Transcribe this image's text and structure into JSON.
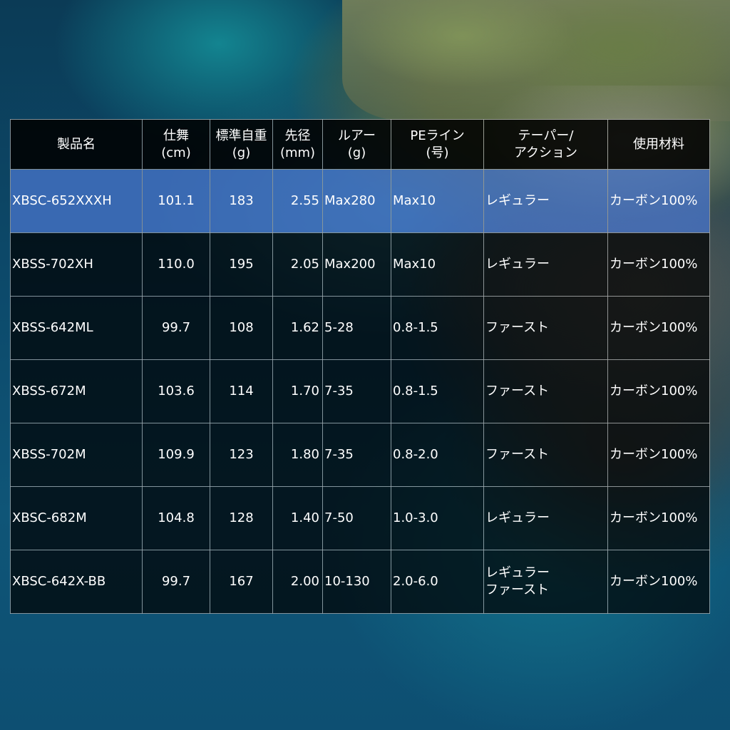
{
  "table": {
    "headers": [
      [
        "製品名"
      ],
      [
        "仕舞",
        "(cm)"
      ],
      [
        "標準自重",
        "(g)"
      ],
      [
        "先径",
        "(mm)"
      ],
      [
        "ルアー",
        "(g)"
      ],
      [
        "PEライン",
        "(号)"
      ],
      [
        "テーパー/",
        "アクション"
      ],
      [
        "使用材料"
      ]
    ],
    "rows": [
      {
        "name": "XBSC-652XXXH",
        "length": "101.1",
        "weight": "183",
        "tip": "2.55",
        "lure": "Max280",
        "line": "Max10",
        "action": [
          "レギュラー"
        ],
        "material": "カーボン100%",
        "highlighted": true
      },
      {
        "name": "XBSS-702XH",
        "length": "110.0",
        "weight": "195",
        "tip": "2.05",
        "lure": "Max200",
        "line": "Max10",
        "action": [
          "レギュラー"
        ],
        "material": "カーボン100%",
        "highlighted": false
      },
      {
        "name": "XBSS-642ML",
        "length": "99.7",
        "weight": "108",
        "tip": "1.62",
        "lure": "5-28",
        "line": "0.8-1.5",
        "action": [
          "ファースト"
        ],
        "material": "カーボン100%",
        "highlighted": false
      },
      {
        "name": "XBSS-672M",
        "length": "103.6",
        "weight": "114",
        "tip": "1.70",
        "lure": "7-35",
        "line": "0.8-1.5",
        "action": [
          "ファースト"
        ],
        "material": "カーボン100%",
        "highlighted": false
      },
      {
        "name": "XBSS-702M",
        "length": "109.9",
        "weight": "123",
        "tip": "1.80",
        "lure": "7-35",
        "line": "0.8-2.0",
        "action": [
          "ファースト"
        ],
        "material": "カーボン100%",
        "highlighted": false
      },
      {
        "name": "XBSC-682M",
        "length": "104.8",
        "weight": "128",
        "tip": "1.40",
        "lure": "7-50",
        "line": "1.0-3.0",
        "action": [
          "レギュラー"
        ],
        "material": "カーボン100%",
        "highlighted": false
      },
      {
        "name": "XBSC-642X-BB",
        "length": "99.7",
        "weight": "167",
        "tip": "2.00",
        "lure": "10-130",
        "line": "2.0-6.0",
        "action": [
          "レギュラー",
          "ファースト"
        ],
        "material": "カーボン100%",
        "highlighted": false
      }
    ]
  },
  "colors": {
    "header_bg": "#000000",
    "row_bg": "#000000",
    "highlight_bg": "#4673c8",
    "text": "#ffffff"
  }
}
